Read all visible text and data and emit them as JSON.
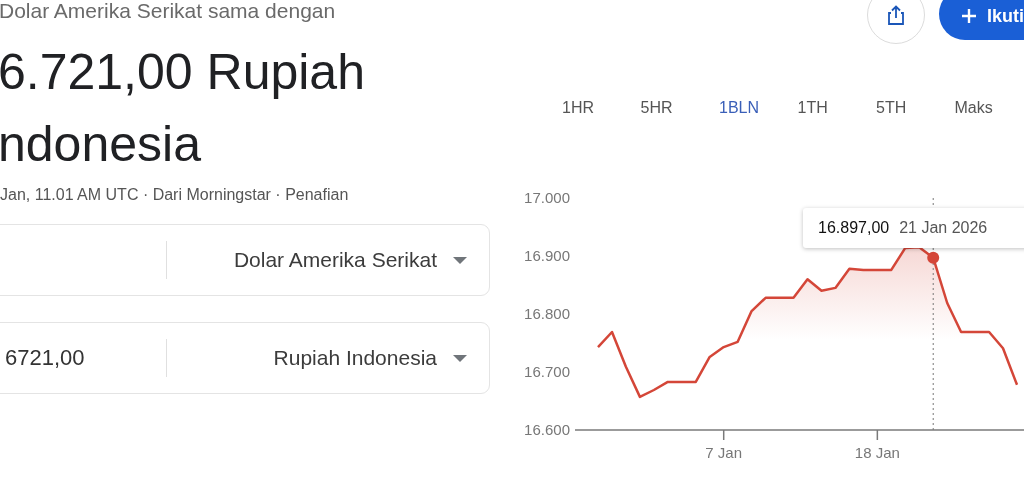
{
  "header": {
    "subtitle": "Dolar Amerika Serikat sama dengan",
    "amount_lines": [
      "6.721,00 Rupiah",
      "ndonesia"
    ],
    "updated": "Jan, 11.01 AM UTC · Dari Morningstar · Penafian"
  },
  "converter": [
    {
      "currency": "Dolar Amerika Serikat"
    },
    {
      "value": "6721,00",
      "currency": "Rupiah Indonesia"
    }
  ],
  "actions": {
    "follow_button": "Ikuti"
  },
  "range_tabs": [
    {
      "label": "1HR",
      "selected": false
    },
    {
      "label": "5HR",
      "selected": false
    },
    {
      "label": "1BLN",
      "selected": true
    },
    {
      "label": "1TH",
      "selected": false
    },
    {
      "label": "5TH",
      "selected": false
    },
    {
      "label": "Maks",
      "selected": false
    }
  ],
  "chart_data": {
    "type": "area",
    "categories": [
      null,
      null,
      null,
      null,
      null,
      null,
      null,
      null,
      null,
      "7 Jan",
      null,
      null,
      null,
      null,
      null,
      null,
      null,
      null,
      null,
      null,
      "18 Jan",
      null,
      null,
      null,
      null,
      null,
      null,
      null,
      null,
      null,
      null
    ],
    "series": [
      {
        "color": "#d44638",
        "values": [
          16743,
          16769,
          16709,
          16657,
          16669,
          16683,
          null,
          16683,
          16726,
          16743,
          16752,
          16805,
          16828,
          null,
          16828,
          16860,
          16840,
          16845,
          16878,
          16876,
          null,
          16876,
          16914,
          16915,
          16897,
          16819,
          16769,
          null,
          16769,
          16741,
          16678
        ]
      }
    ],
    "ylim": [
      16600,
      17000
    ],
    "yticks": [
      {
        "value": 16600,
        "label": "16.600"
      },
      {
        "value": 16700,
        "label": "16.700"
      },
      {
        "value": 16800,
        "label": "16.800"
      },
      {
        "value": 16900,
        "label": "16.900"
      },
      {
        "value": 17000,
        "label": "17.000"
      }
    ]
  },
  "tooltip": {
    "value": "16.897,00",
    "date": "21 Jan 2026"
  }
}
